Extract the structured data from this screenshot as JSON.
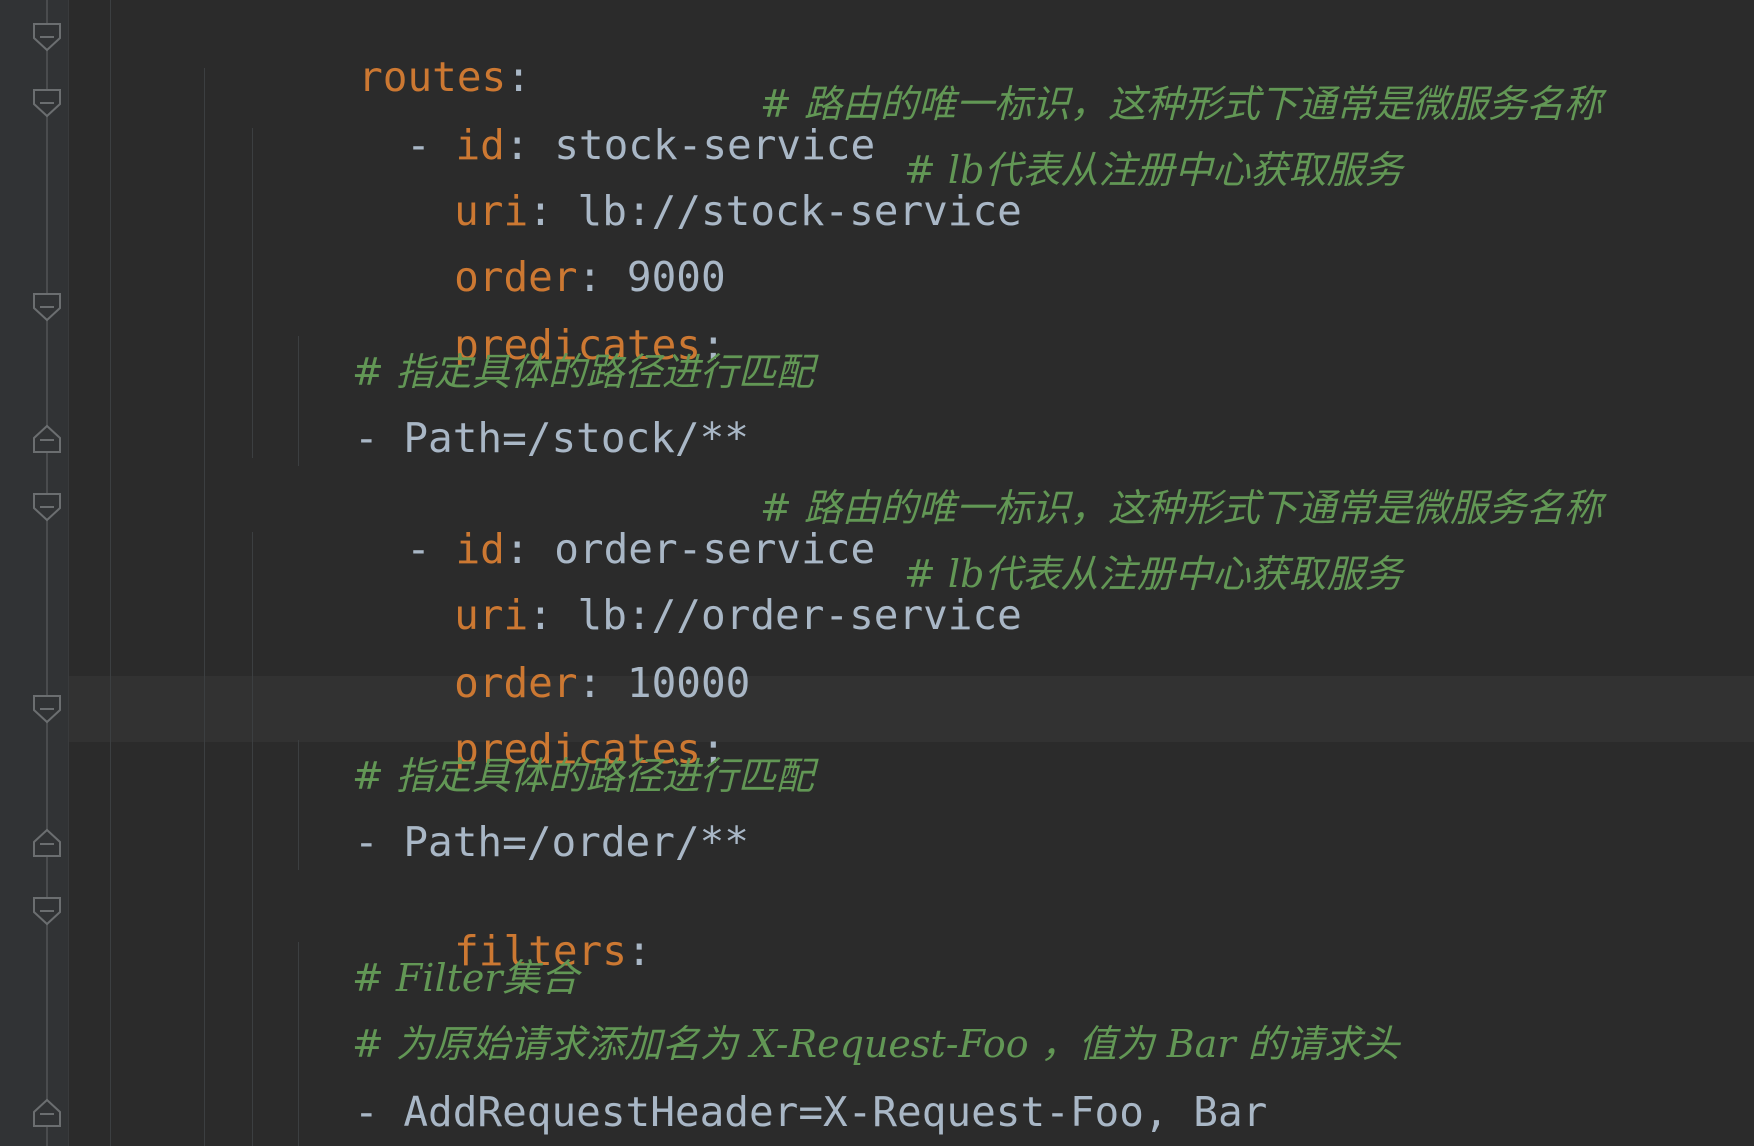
{
  "editor": {
    "colors": {
      "background": "#2b2b2b",
      "gutter": "#313335",
      "key": "#cc7832",
      "text": "#a9b7c6",
      "comment": "#629755"
    },
    "lines": [
      {
        "key": "routes",
        "colon": ":"
      },
      {
        "dash": "-",
        "key": "id",
        "colon": ":",
        "value": "stock-service",
        "comment": "# 路由的唯一标识，这种形式下通常是微服务名称"
      },
      {
        "key": "uri",
        "colon": ":",
        "value": "lb://stock-service",
        "comment": "# lb代表从注册中心获取服务"
      },
      {
        "key": "order",
        "colon": ":",
        "value": "9000"
      },
      {
        "key": "predicates",
        "colon": ":"
      },
      {
        "comment": "# 指定具体的路径进行匹配"
      },
      {
        "text": "- Path=/stock/**"
      },
      {
        "dash": "-",
        "key": "id",
        "colon": ":",
        "value": "order-service",
        "comment": "# 路由的唯一标识，这种形式下通常是微服务名称"
      },
      {
        "key": "uri",
        "colon": ":",
        "value": "lb://order-service",
        "comment": "# lb代表从注册中心获取服务"
      },
      {
        "key": "order",
        "colon": ":",
        "value": "10000"
      },
      {
        "key": "predicates",
        "colon": ":"
      },
      {
        "comment": "# 指定具体的路径进行匹配"
      },
      {
        "text": "- Path=/order/**"
      },
      {
        "key": "filters",
        "colon": ":"
      },
      {
        "comment": "# Filter集合"
      },
      {
        "comment": "# 为原始请求添加名为 X-Request-Foo ，值为 Bar 的请求头"
      },
      {
        "text": "- AddRequestHeader=X-Request-Foo, Bar"
      }
    ]
  }
}
